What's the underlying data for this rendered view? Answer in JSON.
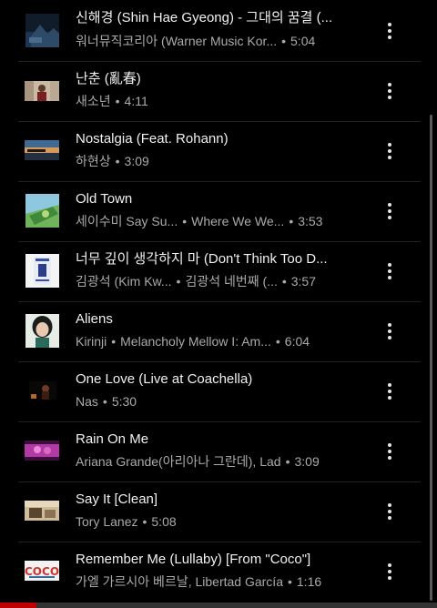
{
  "tracks": [
    {
      "title": "신해경 (Shin Hae Gyeong) - 그대의 꿈결 (...",
      "artist": "워너뮤직코리아 (Warner Music Kor...",
      "album": "",
      "duration": "5:04",
      "thumb_icon": "album-art-dark-landscape"
    },
    {
      "title": "난춘 (亂春)",
      "artist": "새소년",
      "album": "",
      "duration": "4:11",
      "thumb_icon": "album-art-portrait"
    },
    {
      "title": "Nostalgia (Feat. Rohann)",
      "artist": "하현상",
      "album": "",
      "duration": "3:09",
      "thumb_icon": "album-art-sunset"
    },
    {
      "title": "Old Town",
      "artist": "세이수미 Say Su...",
      "album": "Where We We...",
      "duration": "3:53",
      "thumb_icon": "album-art-green-field"
    },
    {
      "title": "너무 깊이 생각하지 마 (Don't Think Too D...",
      "artist": "김광석 (Kim Kw...",
      "album": "김광석 네번째 (...",
      "duration": "3:57",
      "thumb_icon": "album-art-blue-print"
    },
    {
      "title": "Aliens",
      "artist": "Kirinji",
      "album": "Melancholy Mellow I: Am...",
      "duration": "6:04",
      "thumb_icon": "album-art-face-portrait"
    },
    {
      "title": "One Love (Live at Coachella)",
      "artist": "Nas",
      "album": "",
      "duration": "5:30",
      "thumb_icon": "album-art-stage"
    },
    {
      "title": "Rain On Me",
      "artist": "Ariana Grande(아리아나 그란데), Lad",
      "album": "",
      "duration": "3:09",
      "thumb_icon": "album-art-pink-neon"
    },
    {
      "title": "Say It [Clean]",
      "artist": "Tory Lanez",
      "album": "",
      "duration": "5:08",
      "thumb_icon": "album-art-sepia"
    },
    {
      "title": "Remember Me (Lullaby) [From \"Coco\"]",
      "artist": "가엘 가르시아 베르날, Libertad García",
      "album": "",
      "duration": "1:16",
      "thumb_icon": "album-art-coco-logo"
    }
  ],
  "coco_logo_text": "COCO",
  "separator": "•",
  "more_icon": "more-vertical-icon",
  "playback_progress": 0.083,
  "colors": {
    "background": "#000000",
    "title_text": "#f1f1f1",
    "secondary_text": "#aaaaaa",
    "progress": "#c00000"
  }
}
